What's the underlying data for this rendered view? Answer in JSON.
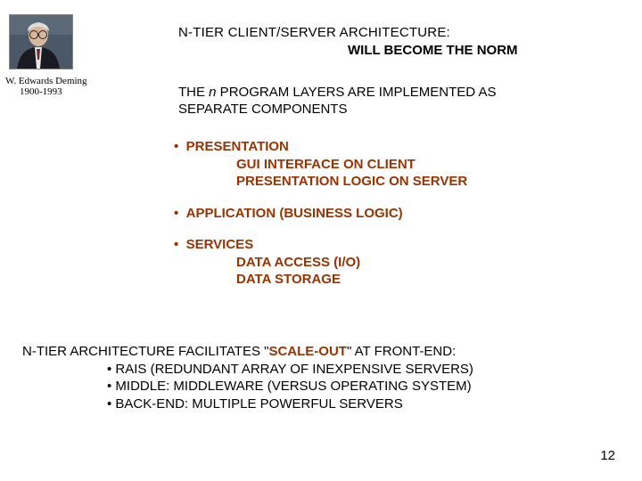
{
  "caption": {
    "name": "W. Edwards Deming",
    "years": "1900-1993"
  },
  "title": {
    "line1": "N-TIER CLIENT/SERVER ARCHITECTURE:",
    "line2": "WILL BECOME THE NORM"
  },
  "intro": {
    "pre": "THE ",
    "nvar": "n",
    "post": " PROGRAM LAYERS ARE IMPLEMENTED AS SEPARATE COMPONENTS"
  },
  "layers": {
    "presentation": {
      "header": "PRESENTATION",
      "sub1": "GUI INTERFACE ON CLIENT",
      "sub2": "PRESENTATION LOGIC ON SERVER"
    },
    "application": {
      "header": "APPLICATION (BUSINESS LOGIC)"
    },
    "services": {
      "header": "SERVICES",
      "sub1": "DATA ACCESS (I/O)",
      "sub2": "DATA STORAGE"
    }
  },
  "bottom": {
    "lead_pre": "N-TIER ARCHITECTURE FACILITATES \"",
    "scaleout": "SCALE-OUT",
    "lead_post": "\" AT FRONT-END:",
    "b1": "• RAIS (REDUNDANT ARRAY OF INEXPENSIVE SERVERS)",
    "b2": "• MIDDLE: MIDDLEWARE (VERSUS OPERATING SYSTEM)",
    "b3": "• BACK-END: MULTIPLE POWERFUL SERVERS"
  },
  "page": "12",
  "bullet": "•"
}
